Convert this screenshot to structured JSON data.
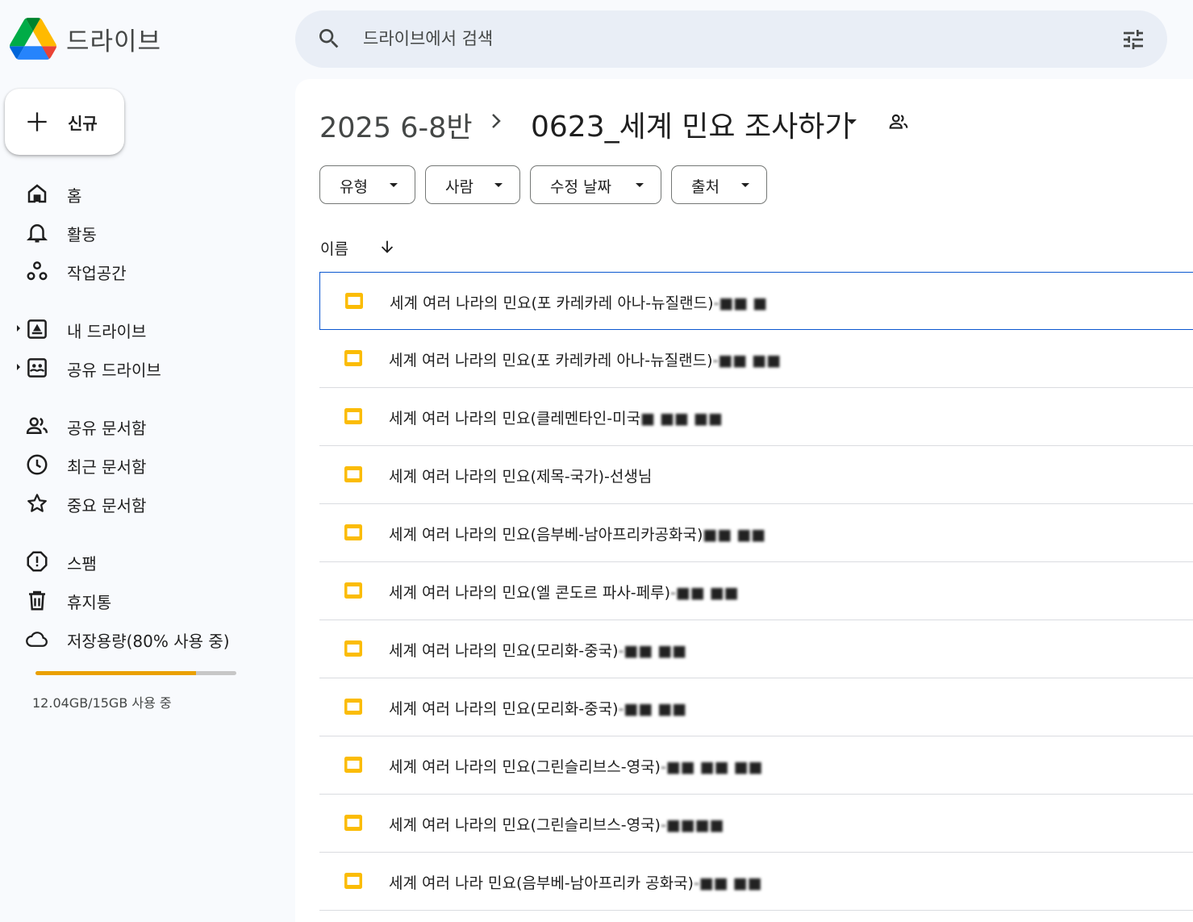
{
  "app": {
    "name": "드라이브",
    "colors": {
      "accent": "#0b57d0",
      "storage_fill": "#eaa000",
      "slides_yellow": "#fbbc04"
    }
  },
  "search": {
    "placeholder": "드라이브에서 검색",
    "value": ""
  },
  "sidebar": {
    "new_label": "신규",
    "items": [
      {
        "label": "홈",
        "icon": "home-icon"
      },
      {
        "label": "활동",
        "icon": "bell-icon"
      },
      {
        "label": "작업공간",
        "icon": "workspaces-icon"
      },
      {
        "label": "내 드라이브",
        "icon": "my-drive-icon",
        "expandable": true
      },
      {
        "label": "공유 드라이브",
        "icon": "shared-drives-icon",
        "expandable": true
      },
      {
        "label": "공유 문서함",
        "icon": "shared-people-icon"
      },
      {
        "label": "최근 문서함",
        "icon": "clock-icon"
      },
      {
        "label": "중요 문서함",
        "icon": "star-icon"
      },
      {
        "label": "스팸",
        "icon": "spam-icon"
      },
      {
        "label": "휴지통",
        "icon": "trash-icon"
      },
      {
        "label": "저장용량(80% 사용 중)",
        "icon": "cloud-icon"
      }
    ],
    "storage": {
      "used_fraction": 0.8,
      "text": "12.04GB/15GB 사용 중"
    }
  },
  "breadcrumb": {
    "root": "2025 6-8반",
    "current": "0623_세계 민요 조사하기"
  },
  "filters": [
    "유형",
    "사람",
    "수정 날짜",
    "출처"
  ],
  "list": {
    "sort_column": "이름",
    "files": [
      {
        "name": "세계 여러 나라의 민요(포 카레카레 아나-뉴질랜드)",
        "suffix": "-■■ ■",
        "selected": true
      },
      {
        "name": "세계 여러 나라의 민요(포 카레카레 아나-뉴질랜드)",
        "suffix": "-■■ ■■"
      },
      {
        "name": "세계 여러 나라의 민요(클레멘타인-미국",
        "suffix": "■ ■■ ■■"
      },
      {
        "name": "세계 여러 나라의 민요(제목-국가)-선생님",
        "suffix": ""
      },
      {
        "name": "세계 여러 나라의 민요(음부베-남아프리카공화국)",
        "suffix": " ■■ ■■"
      },
      {
        "name": "세계 여러 나라의 민요(엘 콘도르 파사-페루)",
        "suffix": "-■■ ■■"
      },
      {
        "name": "세계 여러 나라의 민요(모리화-중국)",
        "suffix": "-■■ ■■"
      },
      {
        "name": "세계 여러 나라의 민요(모리화-중국)",
        "suffix": "-■■ ■■"
      },
      {
        "name": "세계 여러 나라의 민요(그린슬리브스-영국)",
        "suffix": "-■■ ■■ ■■"
      },
      {
        "name": "세계 여러 나라의 민요(그린슬리브스-영국)",
        "suffix": "-■■■■"
      },
      {
        "name": "세계 여러 나라 민요(음부베-남아프리카 공화국)",
        "suffix": "-■■ ■■"
      }
    ]
  }
}
